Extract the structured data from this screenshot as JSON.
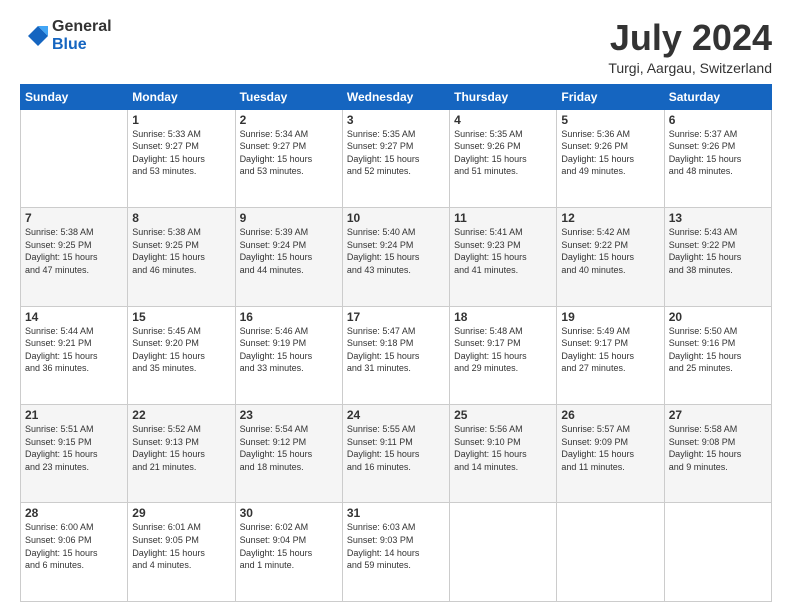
{
  "logo": {
    "general": "General",
    "blue": "Blue"
  },
  "title": {
    "month": "July 2024",
    "location": "Turgi, Aargau, Switzerland"
  },
  "headers": [
    "Sunday",
    "Monday",
    "Tuesday",
    "Wednesday",
    "Thursday",
    "Friday",
    "Saturday"
  ],
  "weeks": [
    [
      {
        "day": "",
        "lines": []
      },
      {
        "day": "1",
        "lines": [
          "Sunrise: 5:33 AM",
          "Sunset: 9:27 PM",
          "Daylight: 15 hours",
          "and 53 minutes."
        ]
      },
      {
        "day": "2",
        "lines": [
          "Sunrise: 5:34 AM",
          "Sunset: 9:27 PM",
          "Daylight: 15 hours",
          "and 53 minutes."
        ]
      },
      {
        "day": "3",
        "lines": [
          "Sunrise: 5:35 AM",
          "Sunset: 9:27 PM",
          "Daylight: 15 hours",
          "and 52 minutes."
        ]
      },
      {
        "day": "4",
        "lines": [
          "Sunrise: 5:35 AM",
          "Sunset: 9:26 PM",
          "Daylight: 15 hours",
          "and 51 minutes."
        ]
      },
      {
        "day": "5",
        "lines": [
          "Sunrise: 5:36 AM",
          "Sunset: 9:26 PM",
          "Daylight: 15 hours",
          "and 49 minutes."
        ]
      },
      {
        "day": "6",
        "lines": [
          "Sunrise: 5:37 AM",
          "Sunset: 9:26 PM",
          "Daylight: 15 hours",
          "and 48 minutes."
        ]
      }
    ],
    [
      {
        "day": "7",
        "lines": [
          "Sunrise: 5:38 AM",
          "Sunset: 9:25 PM",
          "Daylight: 15 hours",
          "and 47 minutes."
        ]
      },
      {
        "day": "8",
        "lines": [
          "Sunrise: 5:38 AM",
          "Sunset: 9:25 PM",
          "Daylight: 15 hours",
          "and 46 minutes."
        ]
      },
      {
        "day": "9",
        "lines": [
          "Sunrise: 5:39 AM",
          "Sunset: 9:24 PM",
          "Daylight: 15 hours",
          "and 44 minutes."
        ]
      },
      {
        "day": "10",
        "lines": [
          "Sunrise: 5:40 AM",
          "Sunset: 9:24 PM",
          "Daylight: 15 hours",
          "and 43 minutes."
        ]
      },
      {
        "day": "11",
        "lines": [
          "Sunrise: 5:41 AM",
          "Sunset: 9:23 PM",
          "Daylight: 15 hours",
          "and 41 minutes."
        ]
      },
      {
        "day": "12",
        "lines": [
          "Sunrise: 5:42 AM",
          "Sunset: 9:22 PM",
          "Daylight: 15 hours",
          "and 40 minutes."
        ]
      },
      {
        "day": "13",
        "lines": [
          "Sunrise: 5:43 AM",
          "Sunset: 9:22 PM",
          "Daylight: 15 hours",
          "and 38 minutes."
        ]
      }
    ],
    [
      {
        "day": "14",
        "lines": [
          "Sunrise: 5:44 AM",
          "Sunset: 9:21 PM",
          "Daylight: 15 hours",
          "and 36 minutes."
        ]
      },
      {
        "day": "15",
        "lines": [
          "Sunrise: 5:45 AM",
          "Sunset: 9:20 PM",
          "Daylight: 15 hours",
          "and 35 minutes."
        ]
      },
      {
        "day": "16",
        "lines": [
          "Sunrise: 5:46 AM",
          "Sunset: 9:19 PM",
          "Daylight: 15 hours",
          "and 33 minutes."
        ]
      },
      {
        "day": "17",
        "lines": [
          "Sunrise: 5:47 AM",
          "Sunset: 9:18 PM",
          "Daylight: 15 hours",
          "and 31 minutes."
        ]
      },
      {
        "day": "18",
        "lines": [
          "Sunrise: 5:48 AM",
          "Sunset: 9:17 PM",
          "Daylight: 15 hours",
          "and 29 minutes."
        ]
      },
      {
        "day": "19",
        "lines": [
          "Sunrise: 5:49 AM",
          "Sunset: 9:17 PM",
          "Daylight: 15 hours",
          "and 27 minutes."
        ]
      },
      {
        "day": "20",
        "lines": [
          "Sunrise: 5:50 AM",
          "Sunset: 9:16 PM",
          "Daylight: 15 hours",
          "and 25 minutes."
        ]
      }
    ],
    [
      {
        "day": "21",
        "lines": [
          "Sunrise: 5:51 AM",
          "Sunset: 9:15 PM",
          "Daylight: 15 hours",
          "and 23 minutes."
        ]
      },
      {
        "day": "22",
        "lines": [
          "Sunrise: 5:52 AM",
          "Sunset: 9:13 PM",
          "Daylight: 15 hours",
          "and 21 minutes."
        ]
      },
      {
        "day": "23",
        "lines": [
          "Sunrise: 5:54 AM",
          "Sunset: 9:12 PM",
          "Daylight: 15 hours",
          "and 18 minutes."
        ]
      },
      {
        "day": "24",
        "lines": [
          "Sunrise: 5:55 AM",
          "Sunset: 9:11 PM",
          "Daylight: 15 hours",
          "and 16 minutes."
        ]
      },
      {
        "day": "25",
        "lines": [
          "Sunrise: 5:56 AM",
          "Sunset: 9:10 PM",
          "Daylight: 15 hours",
          "and 14 minutes."
        ]
      },
      {
        "day": "26",
        "lines": [
          "Sunrise: 5:57 AM",
          "Sunset: 9:09 PM",
          "Daylight: 15 hours",
          "and 11 minutes."
        ]
      },
      {
        "day": "27",
        "lines": [
          "Sunrise: 5:58 AM",
          "Sunset: 9:08 PM",
          "Daylight: 15 hours",
          "and 9 minutes."
        ]
      }
    ],
    [
      {
        "day": "28",
        "lines": [
          "Sunrise: 6:00 AM",
          "Sunset: 9:06 PM",
          "Daylight: 15 hours",
          "and 6 minutes."
        ]
      },
      {
        "day": "29",
        "lines": [
          "Sunrise: 6:01 AM",
          "Sunset: 9:05 PM",
          "Daylight: 15 hours",
          "and 4 minutes."
        ]
      },
      {
        "day": "30",
        "lines": [
          "Sunrise: 6:02 AM",
          "Sunset: 9:04 PM",
          "Daylight: 15 hours",
          "and 1 minute."
        ]
      },
      {
        "day": "31",
        "lines": [
          "Sunrise: 6:03 AM",
          "Sunset: 9:03 PM",
          "Daylight: 14 hours",
          "and 59 minutes."
        ]
      },
      {
        "day": "",
        "lines": []
      },
      {
        "day": "",
        "lines": []
      },
      {
        "day": "",
        "lines": []
      }
    ]
  ]
}
